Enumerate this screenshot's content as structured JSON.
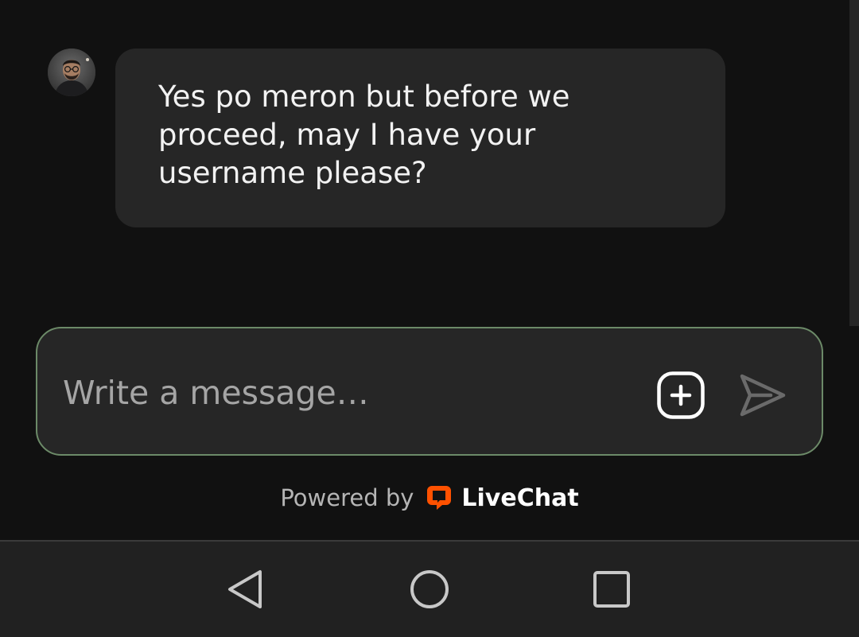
{
  "message": {
    "text": "Yes po meron but before we proceed, may I have your username please?"
  },
  "composer": {
    "placeholder": "Write a message…",
    "value": ""
  },
  "footer": {
    "powered_by": "Powered by",
    "brand": "LiveChat"
  },
  "colors": {
    "background": "#111111",
    "bubble": "#262626",
    "composer_border": "#6c8a68",
    "brand_accent": "#ff5100"
  },
  "icons": {
    "attach": "plus-square-icon",
    "send": "send-icon",
    "back": "back-triangle-icon",
    "home": "home-circle-icon",
    "recents": "recents-square-icon"
  }
}
